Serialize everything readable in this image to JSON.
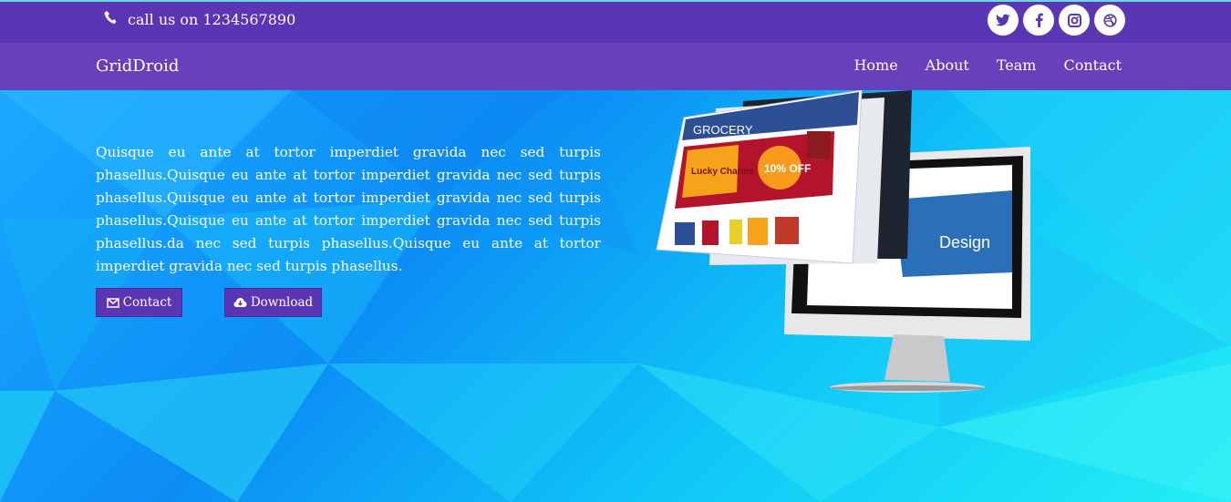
{
  "topbar": {
    "phone_text": "call us on 1234567890",
    "socials": [
      "twitter-icon",
      "facebook-icon",
      "instagram-icon",
      "dribbble-icon"
    ]
  },
  "navbar": {
    "brand": "GridDroid",
    "items": [
      "Home",
      "About",
      "Team",
      "Contact"
    ]
  },
  "hero": {
    "text": "Quisque eu ante at tortor imperdiet gravida nec sed turpis phasellus.Quisque eu ante at tortor imperdiet gravida nec sed turpis phasellus.Quisque eu ante at tortor imperdiet gravida nec sed turpis phasellus.Quisque eu ante at tortor imperdiet gravida nec sed turpis phasellus.da nec sed turpis phasellus.Quisque eu ante at tortor imperdiet gravida nec sed turpis phasellus.",
    "contact_label": "Contact",
    "download_label": "Download"
  },
  "illustration": {
    "badge_text": "10% OFF",
    "brand_text": "Lucky Charms",
    "design_text": "Design",
    "site_text": "GROCERY"
  },
  "colors": {
    "topbar": "#5b36b4",
    "navbar": "#6a3fbb",
    "hero_light": "#23eef5",
    "hero_dark": "#0c8df5"
  }
}
